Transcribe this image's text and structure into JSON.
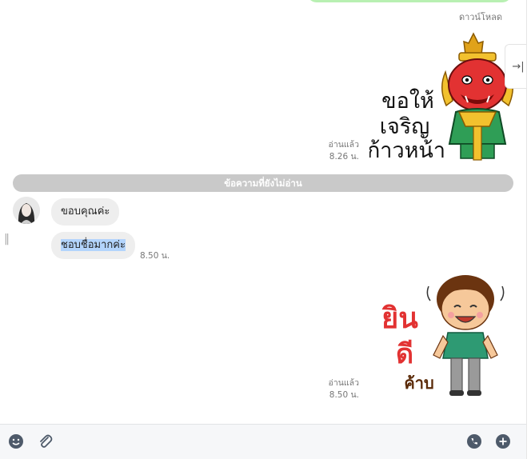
{
  "chat": {
    "download_label": "ดาวน์โหลด",
    "sticker1": {
      "text_lines": [
        "ขอให้",
        "เจริญ",
        "ก้าวหน้า"
      ],
      "read_label": "อ่านแล้ว",
      "time": "8.26 น."
    },
    "unread_divider": "ข้อความที่ยังไม่อ่าน",
    "messages": [
      {
        "text": "ขอบคุณค่ะ"
      },
      {
        "text": "ชอบชื่อมากค่ะ",
        "time": "8.50 น.",
        "selected": true
      }
    ],
    "sticker2": {
      "text_lines": [
        "ยิน",
        "ดี",
        "ค้าบ"
      ],
      "read_label": "อ่านแล้ว",
      "time": "8.50 น."
    }
  },
  "toolbar": {
    "icons": [
      "emoji-icon",
      "attach-icon",
      "call-icon",
      "add-icon"
    ]
  },
  "colors": {
    "bubble": "#eeeeee",
    "divider": "#c9c9c9",
    "sent_bubble": "#b8f0b2",
    "selection": "#b3d4fc"
  }
}
